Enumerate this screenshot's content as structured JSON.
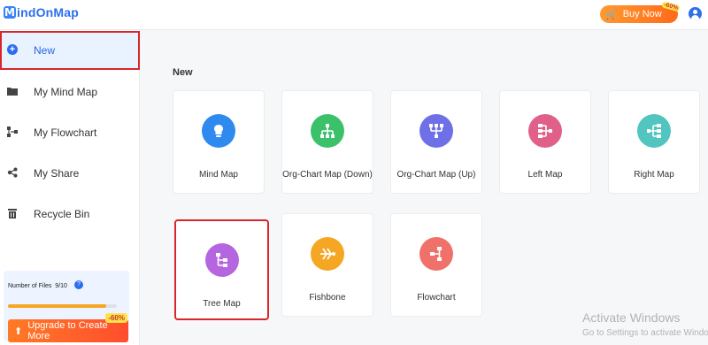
{
  "header": {
    "logo_letter": "M",
    "logo_text": "indOnMap",
    "buy_label": "Buy Now",
    "buy_badge": "-60%"
  },
  "sidebar": {
    "items": [
      {
        "label": "New",
        "icon": "plus-circle-icon",
        "active": true
      },
      {
        "label": "My Mind Map",
        "icon": "folder-icon"
      },
      {
        "label": "My Flowchart",
        "icon": "flowchart-icon"
      },
      {
        "label": "My Share",
        "icon": "share-icon"
      },
      {
        "label": "Recycle Bin",
        "icon": "trash-icon"
      }
    ],
    "files_label": "Number of Files",
    "files_count": "9/10",
    "files_progress": 0.9,
    "upgrade_label": "Upgrade to Create More",
    "upgrade_badge": "-60%"
  },
  "main": {
    "section_title": "New",
    "templates": [
      {
        "label": "Mind Map",
        "icon": "brain-icon",
        "color": "#2f8af0"
      },
      {
        "label": "Org-Chart Map (Down)",
        "icon": "org-chart-down-icon",
        "color": "#3cc16b"
      },
      {
        "label": "Org-Chart Map (Up)",
        "icon": "org-chart-up-icon",
        "color": "#6f6fe8"
      },
      {
        "label": "Left Map",
        "icon": "left-map-icon",
        "color": "#e0608a"
      },
      {
        "label": "Right Map",
        "icon": "right-map-icon",
        "color": "#52c5c0"
      },
      {
        "label": "Tree Map",
        "icon": "tree-map-icon",
        "color": "#b565e0"
      },
      {
        "label": "Fishbone",
        "icon": "fishbone-icon",
        "color": "#f5a623"
      },
      {
        "label": "Flowchart",
        "icon": "flowchart-icon",
        "color": "#f0706a"
      }
    ]
  },
  "watermark": {
    "title": "Activate Windows",
    "subtitle": "Go to Settings to activate Windows."
  }
}
